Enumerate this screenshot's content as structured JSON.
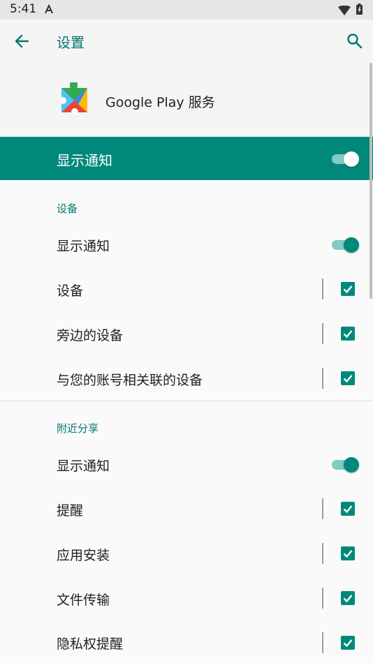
{
  "status_bar": {
    "time": "5:41"
  },
  "app_bar": {
    "title": "设置"
  },
  "app_header": {
    "app_name": "Google Play 服务"
  },
  "master_toggle": {
    "label": "显示通知",
    "on": true
  },
  "sections": [
    {
      "title": "设备",
      "toggle": {
        "label": "显示通知",
        "on": true
      },
      "items": [
        {
          "label": "设备",
          "checked": true
        },
        {
          "label": "旁边的设备",
          "checked": true
        },
        {
          "label": "与您的账号相关联的设备",
          "checked": true
        }
      ]
    },
    {
      "title": "附近分享",
      "toggle": {
        "label": "显示通知",
        "on": true
      },
      "items": [
        {
          "label": "提醒",
          "checked": true
        },
        {
          "label": "应用安装",
          "checked": true
        },
        {
          "label": "文件传输",
          "checked": true
        },
        {
          "label": "隐私权提醒",
          "checked": true
        }
      ]
    }
  ],
  "colors": {
    "accent": "#00897b",
    "accent_dark": "#00796b",
    "switch_track": "#80cbc4"
  }
}
